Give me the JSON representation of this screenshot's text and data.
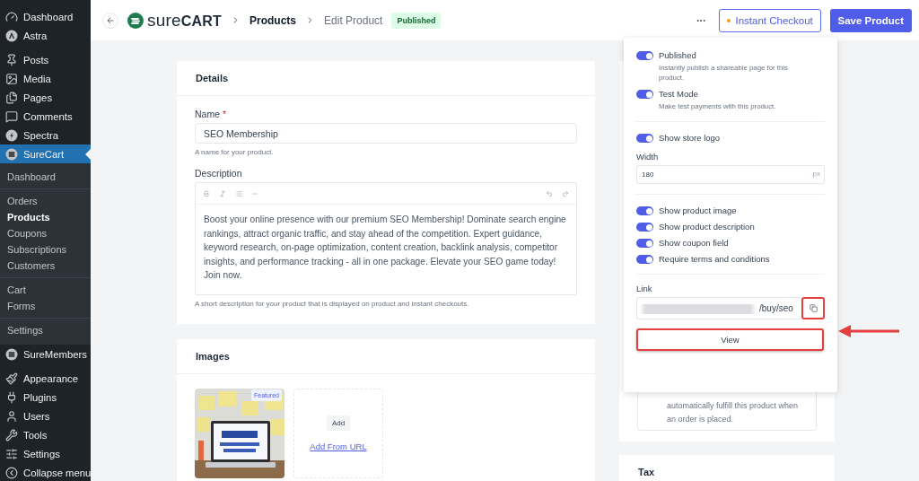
{
  "sidebar": {
    "sections": [
      [
        {
          "label": "Dashboard",
          "selected": false
        },
        {
          "label": "Astra",
          "selected": false
        }
      ],
      [
        {
          "label": "Posts",
          "selected": false
        },
        {
          "label": "Media",
          "selected": false
        },
        {
          "label": "Pages",
          "selected": false
        },
        {
          "label": "Comments",
          "selected": false
        },
        {
          "label": "Spectra",
          "selected": false
        },
        {
          "label": "SureCart",
          "selected": true,
          "groups": [
            {
              "items": [
                {
                  "label": "Dashboard",
                  "selected": false
                }
              ]
            },
            {
              "items": [
                {
                  "label": "Orders",
                  "selected": false
                },
                {
                  "label": "Products",
                  "selected": true
                },
                {
                  "label": "Coupons",
                  "selected": false
                },
                {
                  "label": "Subscriptions",
                  "selected": false
                },
                {
                  "label": "Customers",
                  "selected": false
                }
              ]
            },
            {
              "items": [
                {
                  "label": "Cart",
                  "selected": false
                },
                {
                  "label": "Forms",
                  "selected": false
                }
              ]
            },
            {
              "items": [
                {
                  "label": "Settings",
                  "selected": false
                }
              ]
            }
          ]
        },
        {
          "label": "SureMembers",
          "selected": false
        }
      ],
      [
        {
          "label": "Appearance",
          "selected": false
        },
        {
          "label": "Plugins",
          "selected": false
        },
        {
          "label": "Users",
          "selected": false
        },
        {
          "label": "Tools",
          "selected": false
        },
        {
          "label": "Settings",
          "selected": false
        },
        {
          "label": "Collapse menu",
          "selected": false
        }
      ]
    ]
  },
  "header": {
    "logo": "sure**CART**",
    "breadcrumb": [
      "Products",
      "Edit Product"
    ],
    "status": "Published",
    "checkout_button": {
      "label": "Instant Checkout",
      "expanded": true
    },
    "save_button": "Save Product"
  },
  "details": {
    "title": "Details",
    "name": {
      "label": "Name",
      "required_mark": "*",
      "value": "SEO Membership",
      "help": "A name for your product."
    },
    "description": {
      "label": "Description",
      "value": "Boost your online presence with our premium SEO Membership! Dominate search engine rankings, attract organic traffic, and stay ahead of the competition. Expert guidance, keyword research, on-page optimization, content creation, backlink analysis, competitor insights, and performance tracking - all in one package. Elevate your SEO game today! Join now.",
      "help": "A short description for your product that is displayed on product and instant checkouts."
    }
  },
  "images": {
    "title": "Images",
    "items": [
      {
        "kind": "picture",
        "badge": "Featured"
      }
    ],
    "add_button": "Add",
    "add_url_link": "Add From URL"
  },
  "fulfillment": {
    "text": "automatically fulfill this product when an order is placed."
  },
  "tax": {
    "title": "Tax"
  },
  "checkout_panel": {
    "groups": [
      {
        "toggles": [
          {
            "label": "Published",
            "description": "Instantly publish a shareable page for this product.",
            "on": true
          },
          {
            "label": "Test Mode",
            "description": "Make test payments with this product.",
            "on": true
          }
        ]
      },
      {
        "toggles": [
          {
            "label": "Show store logo",
            "on": true
          }
        ],
        "field": {
          "label": "Width",
          "value": "180",
          "suffix": "px"
        }
      },
      {
        "toggles": [
          {
            "label": "Show product image",
            "on": true
          },
          {
            "label": "Show product description",
            "on": true
          },
          {
            "label": "Show coupon field",
            "on": true
          },
          {
            "label": "Require terms and conditions",
            "on": true
          }
        ]
      }
    ],
    "link": {
      "label": "Link",
      "value": "/buy/seo",
      "copy_highlighted": true
    },
    "view_button": {
      "label": "View",
      "highlighted": true
    }
  }
}
